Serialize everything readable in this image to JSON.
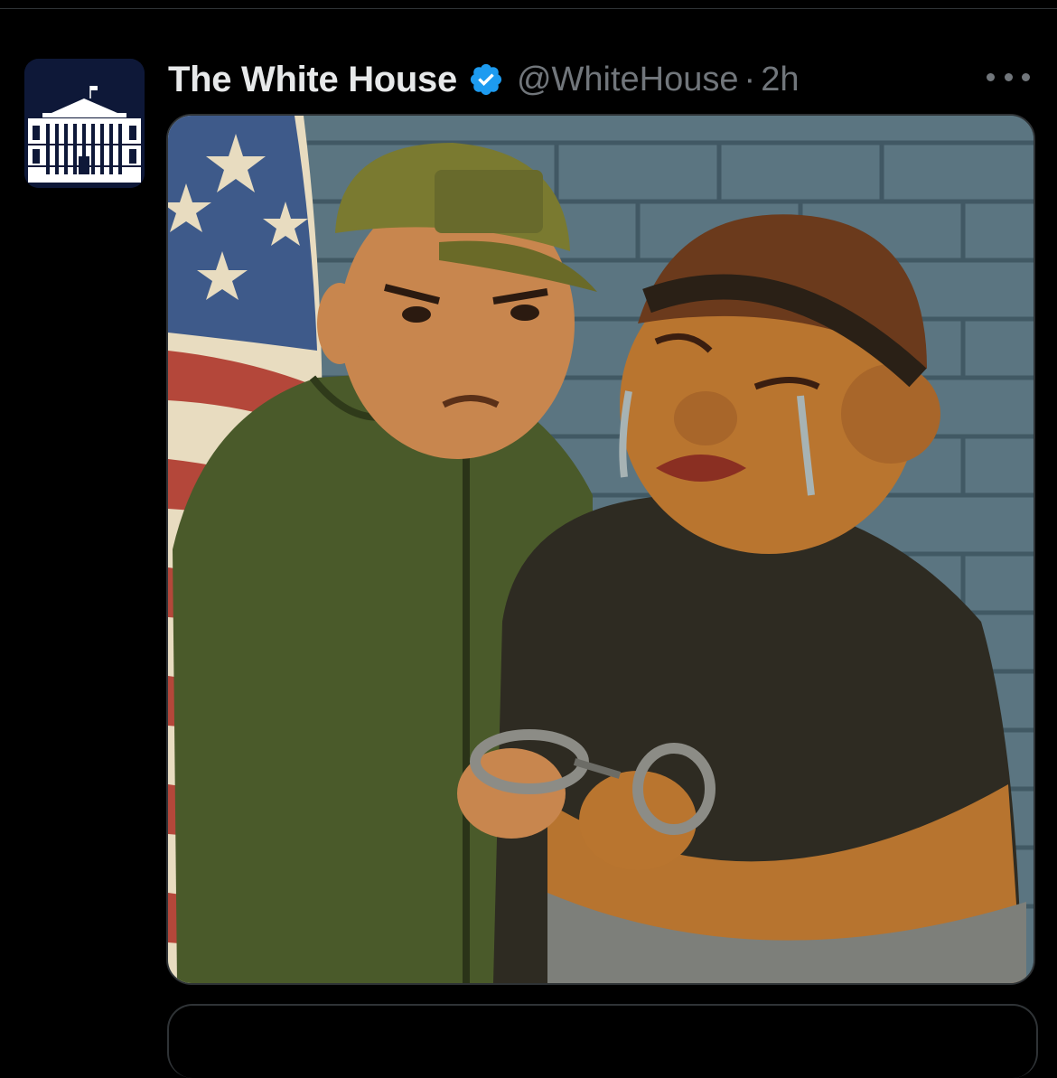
{
  "tweet": {
    "display_name": "The White House",
    "handle": "@WhiteHouse",
    "separator": "·",
    "time": "2h",
    "verified_icon": "verified-badge-icon",
    "more_icon": "more-horizontal-icon",
    "avatar": "white-house-logo",
    "media": "illustration-officer-handcuffing-crying-woman"
  },
  "colors": {
    "background": "#000000",
    "name_text": "#e7e9ea",
    "secondary_text": "#71767b",
    "verified_blue": "#1d9bf0",
    "border": "#2f3336"
  }
}
